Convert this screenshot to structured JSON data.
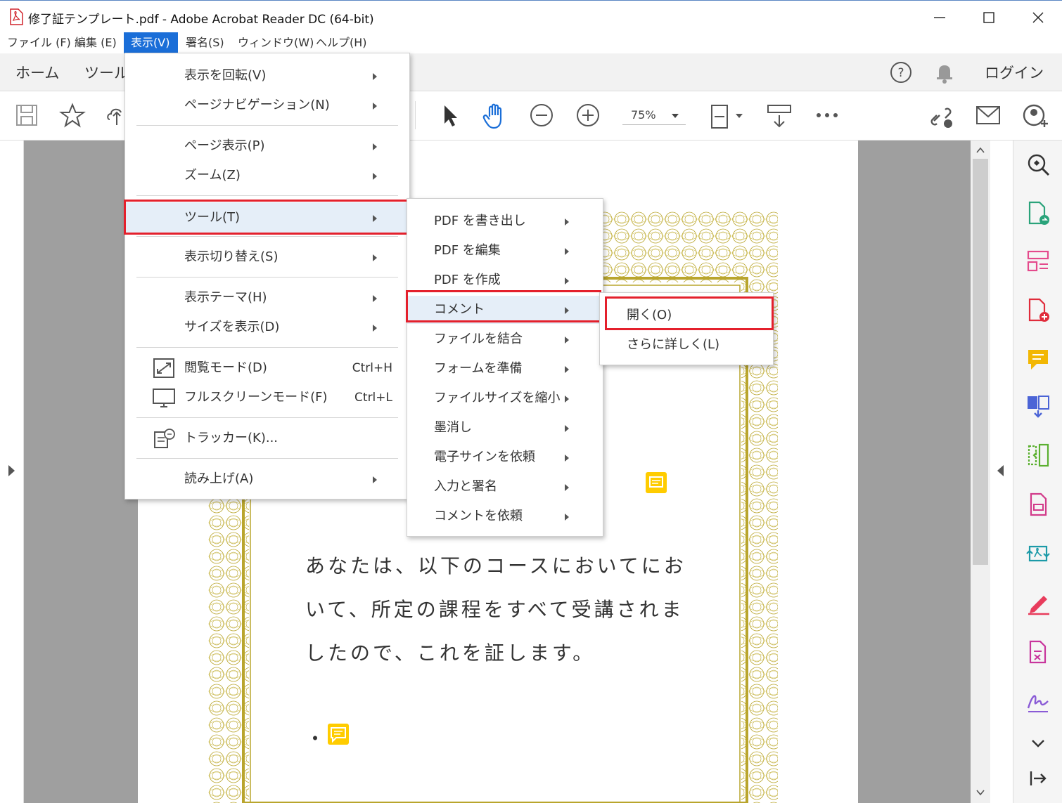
{
  "window": {
    "title": "修了証テンプレート.pdf - Adobe Acrobat Reader DC (64-bit)"
  },
  "menubar": {
    "items": [
      "ファイル (F)",
      "編集 (E)",
      "表示(V)",
      "署名(S)",
      "ウィンドウ(W)",
      "ヘルプ(H)"
    ]
  },
  "tabs": {
    "home": "ホーム",
    "tools": "ツール",
    "login": "ログイン"
  },
  "toolbar": {
    "zoom": "75%"
  },
  "view_menu": {
    "rotate": "表示を回転(V)",
    "page_nav": "ページナビゲーション(N)",
    "page_display": "ページ表示(P)",
    "zoom": "ズーム(Z)",
    "tools": "ツール(T)",
    "toggle": "表示切り替え(S)",
    "theme": "表示テーマ(H)",
    "show_size": "サイズを表示(D)",
    "read_mode": "閲覧モード(D)",
    "read_mode_sc": "Ctrl+H",
    "fullscreen": "フルスクリーンモード(F)",
    "fullscreen_sc": "Ctrl+L",
    "tracker": "トラッカー(K)...",
    "read_aloud": "読み上げ(A)"
  },
  "tools_submenu": {
    "items": [
      "PDF を書き出し",
      "PDF を編集",
      "PDF を作成",
      "コメント",
      "ファイルを結合",
      "フォームを準備",
      "ファイルサイズを縮小",
      "墨消し",
      "電子サインを依頼",
      "入力と署名",
      "コメントを依頼"
    ]
  },
  "comment_submenu": {
    "open": "開く(O)",
    "more": "さらに詳しく(L)"
  },
  "document": {
    "line1": "あなたは、以下のコースにおいてにお",
    "line2": "いて、所定の課程をすべて受講されま",
    "line3": "したので、これを証します。",
    "bullet": "・"
  },
  "colors": {
    "accent": "#1a6ed8",
    "highlight_red": "#e4202c",
    "note_yellow": "#ffcc00",
    "border_gold": "#b9a52d"
  }
}
